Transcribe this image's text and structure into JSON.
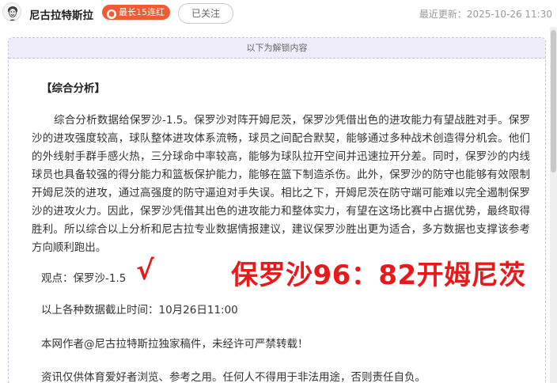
{
  "header": {
    "author_name": "尼古拉特斯拉",
    "streak_badge": "最长15连红",
    "follow_label": "已关注",
    "last_updated_label": "最近更新：",
    "last_updated_value": "2025-10-26 11:30"
  },
  "content": {
    "unlock_banner": "以下为解锁内容",
    "section_title": "【综合分析】",
    "paragraph": "综合分析数据给保罗沙-1.5。保罗沙对阵开姆尼茨，保罗沙凭借出色的进攻能力有望战胜对手。保罗沙的进攻强度较高，球队整体进攻体系流畅，球员之间配合默契，能够通过多种战术创造得分机会。他们的外线射手群手感火热，三分球命中率较高，能够为球队拉开空间并迅速拉开分差。同时，保罗沙的内线球员也具备较强的得分能力和篮板保护能力，能够在篮下制造杀伤。此外，保罗沙的防守也能够有效限制开姆尼茨的进攻，通过高强度的防守逼迫对手失误。相比之下，开姆尼茨在防守端可能难以完全遏制保罗沙的进攻火力。因此，保罗沙凭借其出色的进攻能力和整体实力，有望在这场比赛中占据优势，最终取得胜利。所以综合以上分析和尼古拉专业数据情报建议，建议保罗沙胜出更为适合，多方数据也支撑该参考方向顺利跑出。",
    "viewpoint": "观点：保罗沙-1.5",
    "check_mark": "√",
    "final_score": "保罗沙96：82开姆尼茨",
    "data_cutoff": "以上各种数据截止时间：10月26日11:00",
    "copyright": "本网作者@尼古拉特斯拉独家稿件，未经许可严禁转载！",
    "disclaimer": "资讯仅供体育爱好者浏览、参考之用。任何人不得用于非法用途，否则责任自负。"
  },
  "colors": {
    "streak_badge": "#f05b33",
    "result_red": "#e8191b",
    "panel_border": "#c4bde8",
    "banner_bg": "#efedf9"
  },
  "icons": {
    "avatar": "tesla-portrait-avatar",
    "streak": "flame-icon"
  }
}
